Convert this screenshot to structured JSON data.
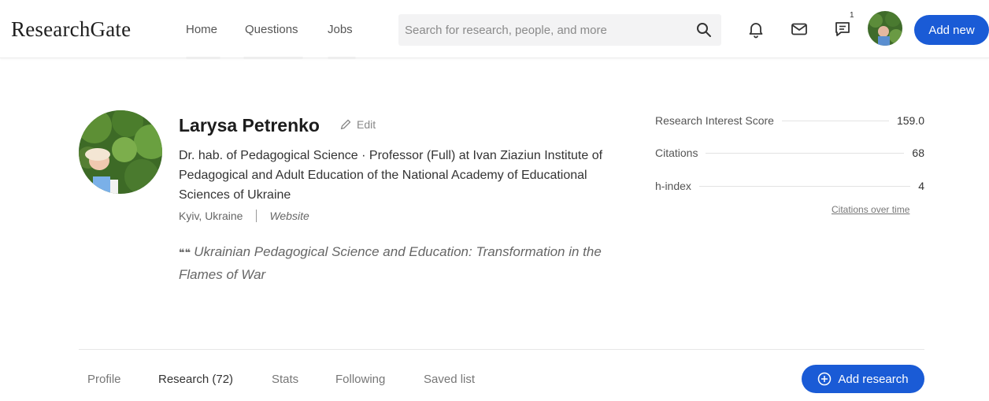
{
  "header": {
    "logo": "ResearchGate",
    "nav": {
      "home": "Home",
      "questions": "Questions",
      "jobs": "Jobs"
    },
    "search": {
      "placeholder": "Search for research, people, and more",
      "icon": "search-icon"
    },
    "notification_badge": "1",
    "add_new_label": "Add new",
    "accent_color": "#1a5bd6"
  },
  "profile": {
    "name": "Larysa Petrenko",
    "edit_label": "Edit",
    "affiliation": "Dr. hab. of Pedagogical Science  · Professor (Full) at Ivan Ziaziun Institute of Pedagogical and Adult Education of the National Academy of Educational Sciences of Ukraine",
    "location": "Kyiv, Ukraine",
    "website_label": "Website",
    "quote_mark": "❝❝",
    "quote": "Ukrainian Pedagogical Science and Education: Transformation in the Flames of War"
  },
  "stats": {
    "items": [
      {
        "label": "Research Interest Score",
        "value": "159.0"
      },
      {
        "label": "Citations",
        "value": "68"
      },
      {
        "label": "h-index",
        "value": "4"
      }
    ],
    "citations_over_time": "Citations over time"
  },
  "tabs": {
    "items": [
      {
        "label": "Profile"
      },
      {
        "label": "Research (72)"
      },
      {
        "label": "Stats"
      },
      {
        "label": "Following"
      },
      {
        "label": "Saved list"
      }
    ],
    "active": "Research (72)"
  },
  "add_research_label": "Add research"
}
